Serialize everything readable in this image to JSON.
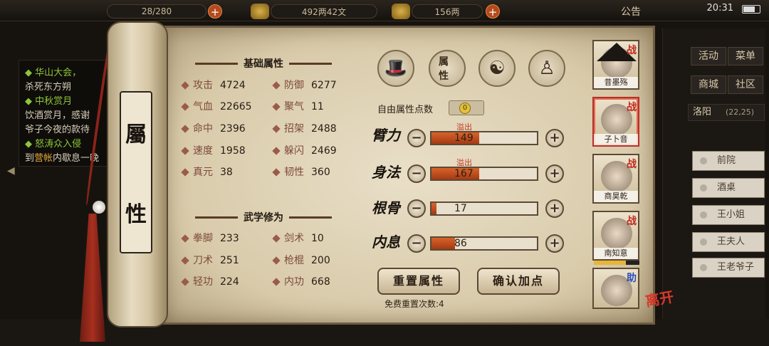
{
  "topbar": {
    "stamina": "28/280",
    "silver": "492两42文",
    "gold": "156两",
    "announce": "公告",
    "time": "20:31"
  },
  "quests": [
    {
      "title": "华山大会，",
      "desc": "杀死东方朔"
    },
    {
      "title": "中秋赏月",
      "desc": "饮酒赏月，感谢",
      "desc2": "爷子今夜的款待"
    },
    {
      "title": "怒涛众入侵",
      "desc_prefix": "到",
      "desc_hl": "营帐",
      "desc_suffix": "内歇息一晚"
    }
  ],
  "menu": [
    "活动",
    "菜单",
    "商城",
    "社区"
  ],
  "location": {
    "name": "洛阳",
    "coords": "(22,25)"
  },
  "places": [
    "前院",
    "酒桌",
    "王小姐",
    "王夫人",
    "王老爷子"
  ],
  "scroll_title": [
    "屬",
    "性"
  ],
  "basic": {
    "header": "基础属性",
    "stats": [
      {
        "label": "攻击",
        "value": "4724"
      },
      {
        "label": "防御",
        "value": "6277"
      },
      {
        "label": "气血",
        "value": "22665"
      },
      {
        "label": "聚气",
        "value": "11"
      },
      {
        "label": "命中",
        "value": "2396"
      },
      {
        "label": "招架",
        "value": "2488"
      },
      {
        "label": "速度",
        "value": "1958"
      },
      {
        "label": "躲闪",
        "value": "2469"
      },
      {
        "label": "真元",
        "value": "38"
      },
      {
        "label": "韧性",
        "value": "360"
      }
    ]
  },
  "martial": {
    "header": "武学修为",
    "stats": [
      {
        "label": "拳脚",
        "value": "233"
      },
      {
        "label": "剑术",
        "value": "10"
      },
      {
        "label": "刀术",
        "value": "251"
      },
      {
        "label": "枪棍",
        "value": "200"
      },
      {
        "label": "轻功",
        "value": "224"
      },
      {
        "label": "内功",
        "value": "668"
      }
    ]
  },
  "tab_icons": [
    "hat-icon",
    "scroll-attr-icon",
    "yinyang-icon",
    "body-icon"
  ],
  "tab_attr_label": "属性",
  "free_points_label": "自由属性点数",
  "free_points": "0",
  "attributes": [
    {
      "label": "臂力",
      "value": "149",
      "fill": 0.45,
      "overflow": "溢出"
    },
    {
      "label": "身法",
      "value": "167",
      "fill": 0.45,
      "overflow": "溢出"
    },
    {
      "label": "根骨",
      "value": "17",
      "fill": 0.05,
      "overflow": ""
    },
    {
      "label": "内息",
      "value": "86",
      "fill": 0.22,
      "overflow": ""
    }
  ],
  "buttons": {
    "reset": "重置属性",
    "confirm": "确认加点",
    "free_reset": "免费重置次数:4"
  },
  "party": [
    {
      "name": "昔墨殇",
      "tag": "战"
    },
    {
      "name": "子卜音",
      "tag": "战"
    },
    {
      "name": "商昊乾",
      "tag": "战"
    },
    {
      "name": "南知意",
      "tag": "战"
    },
    {
      "name": "",
      "tag": "助"
    }
  ],
  "leave_label": "离开",
  "colors": {
    "accent": "#b34a1e",
    "bar_fill": "#d8632a",
    "overflow": "#c2341e"
  }
}
